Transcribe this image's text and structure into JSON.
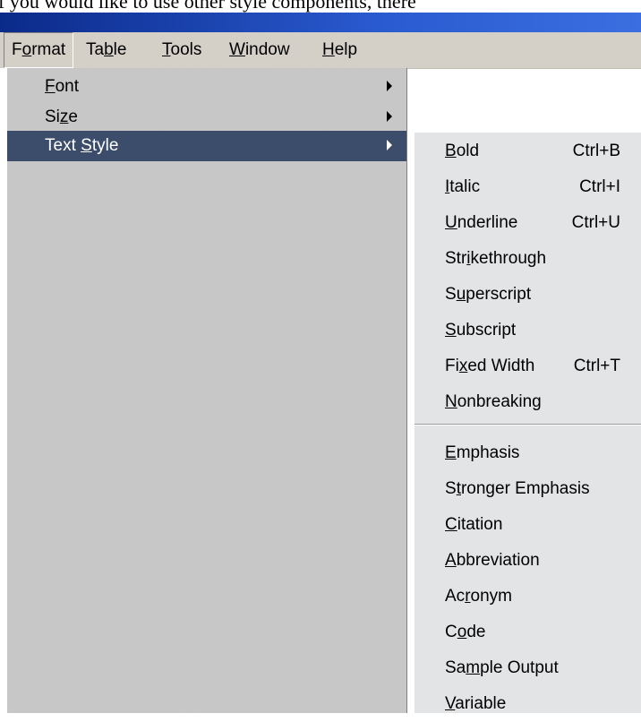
{
  "document": {
    "partial_text": "f you would like to use other style components, there"
  },
  "menu_bar": {
    "items": [
      {
        "label": "Format",
        "mnemonic_index": 1
      },
      {
        "label": "Table",
        "mnemonic_index": 2
      },
      {
        "label": "Tools",
        "mnemonic_index": 0
      },
      {
        "label": "Window",
        "mnemonic_index": 0
      },
      {
        "label": "Help",
        "mnemonic_index": 0
      }
    ]
  },
  "format_menu": {
    "items": [
      {
        "label": "Font",
        "mnemonic_index": 0,
        "has_submenu": true
      },
      {
        "label": "Size",
        "mnemonic_index": 2,
        "has_submenu": true
      },
      {
        "label": "Text Style",
        "mnemonic_index": 5,
        "has_submenu": true,
        "highlighted": true
      }
    ]
  },
  "text_style_menu": {
    "group1": [
      {
        "label": "Bold",
        "mnemonic_index": 0,
        "shortcut": "Ctrl+B"
      },
      {
        "label": "Italic",
        "mnemonic_index": 0,
        "shortcut": "Ctrl+I"
      },
      {
        "label": "Underline",
        "mnemonic_index": 0,
        "shortcut": "Ctrl+U"
      },
      {
        "label": "Strikethrough",
        "mnemonic_index": 3,
        "shortcut": ""
      },
      {
        "label": "Superscript",
        "mnemonic_index": 1,
        "shortcut": ""
      },
      {
        "label": "Subscript",
        "mnemonic_index": 0,
        "shortcut": ""
      },
      {
        "label": "Fixed Width",
        "mnemonic_index": 2,
        "shortcut": "Ctrl+T"
      },
      {
        "label": "Nonbreaking",
        "mnemonic_index": 0,
        "shortcut": ""
      }
    ],
    "group2": [
      {
        "label": "Emphasis",
        "mnemonic_index": 0,
        "shortcut": ""
      },
      {
        "label": "Stronger Emphasis",
        "mnemonic_index": 1,
        "shortcut": ""
      },
      {
        "label": "Citation",
        "mnemonic_index": 0,
        "shortcut": ""
      },
      {
        "label": "Abbreviation",
        "mnemonic_index": 0,
        "shortcut": ""
      },
      {
        "label": "Acronym",
        "mnemonic_index": 2,
        "shortcut": ""
      },
      {
        "label": "Code",
        "mnemonic_index": 1,
        "shortcut": ""
      },
      {
        "label": "Sample Output",
        "mnemonic_index": 2,
        "shortcut": ""
      },
      {
        "label": "Variable",
        "mnemonic_index": 0,
        "shortcut": ""
      }
    ]
  },
  "colors": {
    "menu_bar_bg": "#d4d0c8",
    "menu_bg": "#c6c6c6",
    "submenu_bg": "#e3e4e6",
    "highlight_bg": "#3b4d6a",
    "title_bar": "#2a5bd0"
  }
}
